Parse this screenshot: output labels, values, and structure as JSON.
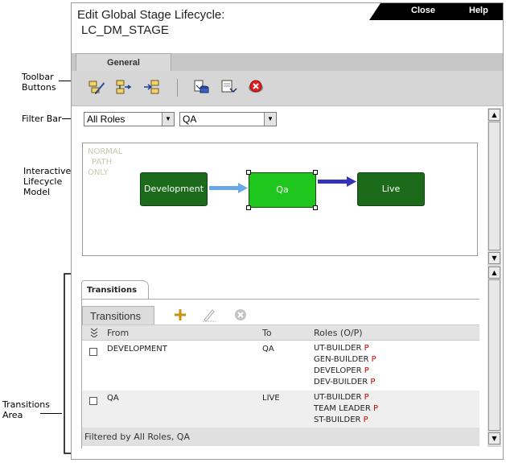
{
  "callouts": {
    "toolbar_buttons": [
      "Toolbar",
      "Buttons"
    ],
    "filter_bar": "Filter Bar",
    "interactive_model": [
      "Interactive",
      "Lifecycle",
      "Model"
    ],
    "transitions_area": [
      "Transitions",
      "Area"
    ]
  },
  "header": {
    "title": "Edit Global Stage Lifecycle:",
    "subtitle": "LC_DM_STAGE",
    "close_label": "Close",
    "help_label": "Help"
  },
  "tabs": [
    {
      "label": "General"
    }
  ],
  "toolbar": {
    "buttons": [
      "edit-lifecycle-icon",
      "add-stage-icon",
      "add-transition-icon",
      "import-icon",
      "export-icon",
      "delete-icon"
    ]
  },
  "filter": {
    "role_value": "All Roles",
    "stage_value": "QA"
  },
  "model": {
    "watermark": [
      "NORMAL",
      "PATH",
      "ONLY"
    ],
    "nodes": [
      "Development",
      "Qa",
      "Live"
    ],
    "colors": {
      "stage": "#1b6b1b",
      "selected": "#1ec61e",
      "arrow_in": "#6aa7e8",
      "arrow_out": "#3434b8"
    }
  },
  "transitions": {
    "tab_label": "Transitions",
    "subtab_label": "Transitions",
    "columns": {
      "from": "From",
      "to": "To",
      "roles": "Roles (O/P)"
    },
    "rows": [
      {
        "from": "DEVELOPMENT",
        "to": "QA",
        "roles": [
          {
            "name": "UT-BUILDER",
            "flag": "P"
          },
          {
            "name": "GEN-BUILDER",
            "flag": "P"
          },
          {
            "name": "DEVELOPER",
            "flag": "P"
          },
          {
            "name": "DEV-BUILDER",
            "flag": "P"
          }
        ]
      },
      {
        "from": "QA",
        "to": "LIVE",
        "roles": [
          {
            "name": "UT-BUILDER",
            "flag": "P"
          },
          {
            "name": "TEAM LEADER",
            "flag": "P"
          },
          {
            "name": "ST-BUILDER",
            "flag": "P"
          }
        ]
      }
    ],
    "footer": "Filtered by All Roles, QA"
  }
}
